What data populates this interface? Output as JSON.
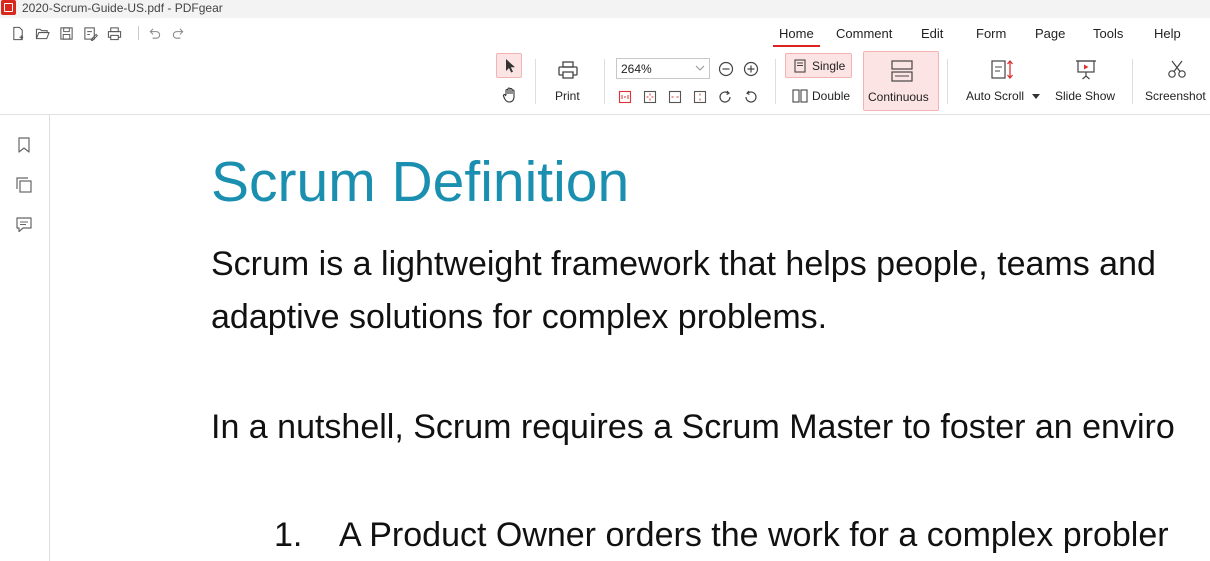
{
  "window": {
    "title": "2020-Scrum-Guide-US.pdf - PDFgear"
  },
  "quick_access": {
    "icons": [
      "new-file-icon",
      "open-folder-icon",
      "save-icon",
      "save-as-icon",
      "print-icon",
      "undo-icon",
      "redo-icon"
    ]
  },
  "tabs": [
    {
      "label": "Home",
      "active": true
    },
    {
      "label": "Comment"
    },
    {
      "label": "Edit"
    },
    {
      "label": "Form"
    },
    {
      "label": "Page"
    },
    {
      "label": "Tools"
    },
    {
      "label": "Help"
    }
  ],
  "toolbar": {
    "print_label": "Print",
    "zoom_value": "264%",
    "single_label": "Single",
    "double_label": "Double",
    "continuous_label": "Continuous",
    "auto_scroll_label": "Auto Scroll",
    "slide_show_label": "Slide Show",
    "screenshot_label": "Screenshot"
  },
  "colors": {
    "accent": "#d22222",
    "title_blue": "#1a8fb0",
    "selected_bg": "#fde4e4"
  },
  "document": {
    "heading": "Scrum Definition",
    "para1_line1": "Scrum is a lightweight framework that helps people, teams and",
    "para1_line2": "adaptive solutions for complex problems.",
    "para2_line1": "In a nutshell, Scrum requires a Scrum Master to foster an enviro",
    "list_item_1_num": "1.",
    "list_item_1_text": "A Product Owner orders the work for a complex probler"
  }
}
